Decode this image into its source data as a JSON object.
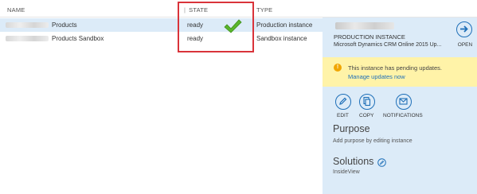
{
  "table": {
    "headers": {
      "name": "NAME",
      "state": "STATE",
      "type": "TYPE"
    },
    "rows": [
      {
        "name": "Products",
        "state": "ready",
        "type": "Production instance"
      },
      {
        "name": "Products Sandbox",
        "state": "ready",
        "type": "Sandbox instance"
      }
    ]
  },
  "details": {
    "instance_type": "PRODUCTION INSTANCE",
    "version": "Microsoft Dynamics CRM Online 2015 Up...",
    "open_label": "OPEN",
    "notice": {
      "message": "This instance has pending updates.",
      "link": "Manage updates now"
    },
    "actions": {
      "edit": "EDIT",
      "copy": "COPY",
      "notifications": "NOTIFICATIONS"
    },
    "purpose": {
      "heading": "Purpose",
      "text": "Add purpose by editing instance"
    },
    "solutions": {
      "heading": "Solutions",
      "item": "InsideView"
    }
  },
  "colors": {
    "accent": "#1e6fb8",
    "selected_row": "#dcebf8",
    "warning_bg": "#fff3a8",
    "highlight": "#d9333a",
    "check": "#5ab52b"
  },
  "icons": [
    "check-icon",
    "open-arrow-icon",
    "warning-icon",
    "edit-pencil-icon",
    "copy-icon",
    "notifications-icon",
    "edit-small-icon"
  ]
}
